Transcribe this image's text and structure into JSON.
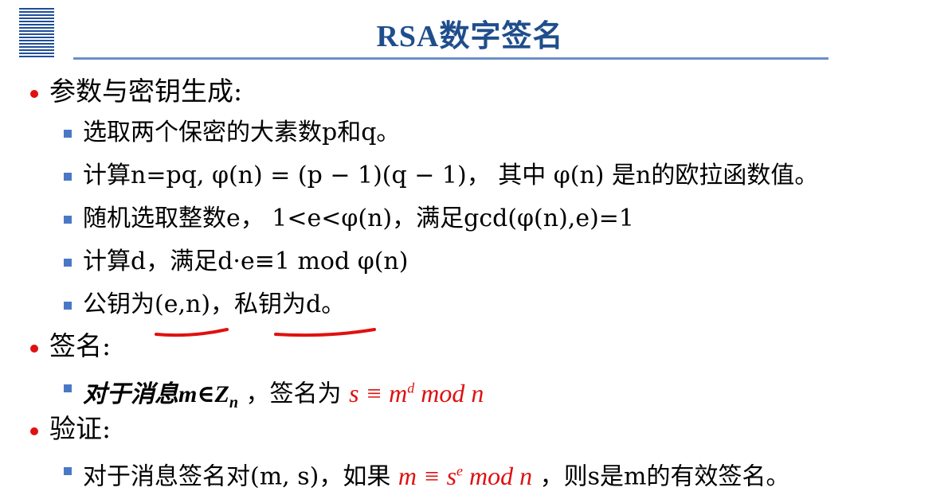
{
  "title": "RSA数字签名",
  "sections": [
    {
      "heading": "参数与密钥生成:",
      "items": [
        "选取两个保密的大素数p和q。",
        "计算n=pq, φ(n) = (p − 1)(q − 1)， 其中 φ(n) 是n的欧拉函数值。",
        "随机选取整数e， 1<e<φ(n)，满足gcd(φ(n),e)=1",
        "计算d，满足d·e≡1 mod φ(n)",
        "公钥为(e,n)，私钥为d。"
      ]
    },
    {
      "heading": "签名:",
      "item_prefix": "对于消息m∈Z",
      "item_sub": "n",
      "item_mid": " ，签名为 ",
      "formula_base": "s ≡ m",
      "formula_sup": "d",
      "formula_tail": " mod n"
    },
    {
      "heading": "验证:",
      "item_prefix": "对于消息签名对(m, s)，如果 ",
      "formula_base": "m ≡ s",
      "formula_sup": "e",
      "formula_tail": " mod n",
      "item_suffix": " ，则s是m的有效签名。"
    }
  ],
  "colors": {
    "title": "#1f4e8c",
    "bullet_dot": "#e01010",
    "bullet_square": "#4a78c7",
    "formula": "#e01010",
    "annotation": "#e01010"
  }
}
